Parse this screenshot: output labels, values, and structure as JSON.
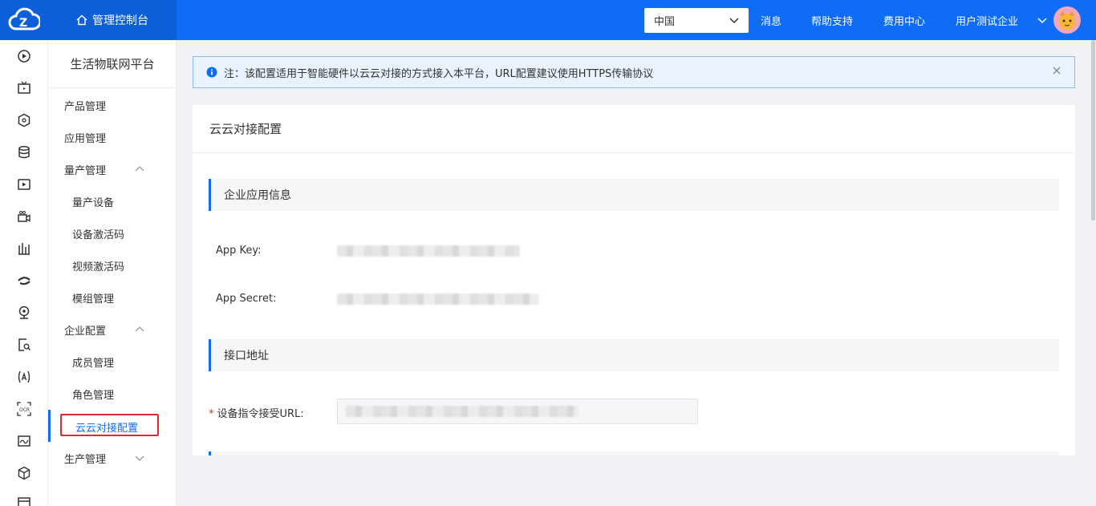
{
  "header": {
    "console_label": "管理控制台",
    "region": "中国",
    "links": [
      "消息",
      "帮助支持",
      "费用中心",
      "用户测试企业"
    ]
  },
  "rail_icons": [
    "play-circle-icon",
    "tv-icon",
    "hexagon-icon",
    "database-icon",
    "video-frame-icon",
    "camera-icon",
    "chart-bars-icon",
    "eye-swoosh-icon",
    "webcam-icon",
    "doc-search-icon",
    "face-scan-icon",
    "ocr-icon",
    "map-icon",
    "cube-icon",
    "panel-icon"
  ],
  "sidebar": {
    "title": "生活物联网平台",
    "items": [
      {
        "label": "产品管理",
        "level": 1
      },
      {
        "label": "应用管理",
        "level": 1
      },
      {
        "label": "量产管理",
        "level": 1,
        "chevron": "up"
      },
      {
        "label": "量产设备",
        "level": 2
      },
      {
        "label": "设备激活码",
        "level": 2
      },
      {
        "label": "视频激活码",
        "level": 2
      },
      {
        "label": "模组管理",
        "level": 2
      },
      {
        "label": "企业配置",
        "level": 1,
        "chevron": "up"
      },
      {
        "label": "成员管理",
        "level": 2
      },
      {
        "label": "角色管理",
        "level": 2
      },
      {
        "label": "云云对接配置",
        "level": 2,
        "active": true
      },
      {
        "label": "生产管理",
        "level": 1,
        "chevron": "down"
      }
    ]
  },
  "notice": {
    "text": "注：该配置适用于智能硬件以云云对接的方式接入本平台，URL配置建议使用HTTPS传输协议"
  },
  "card": {
    "title": "云云对接配置",
    "section1_title": "企业应用信息",
    "app_key_label": "App Key:",
    "app_secret_label": "App Secret:",
    "section2_title": "接口地址",
    "url_label": "设备指令接受URL:"
  },
  "colors": {
    "primary": "#0f6df5",
    "header_dark": "#0c5fd8",
    "highlight_red": "#e6262a"
  }
}
